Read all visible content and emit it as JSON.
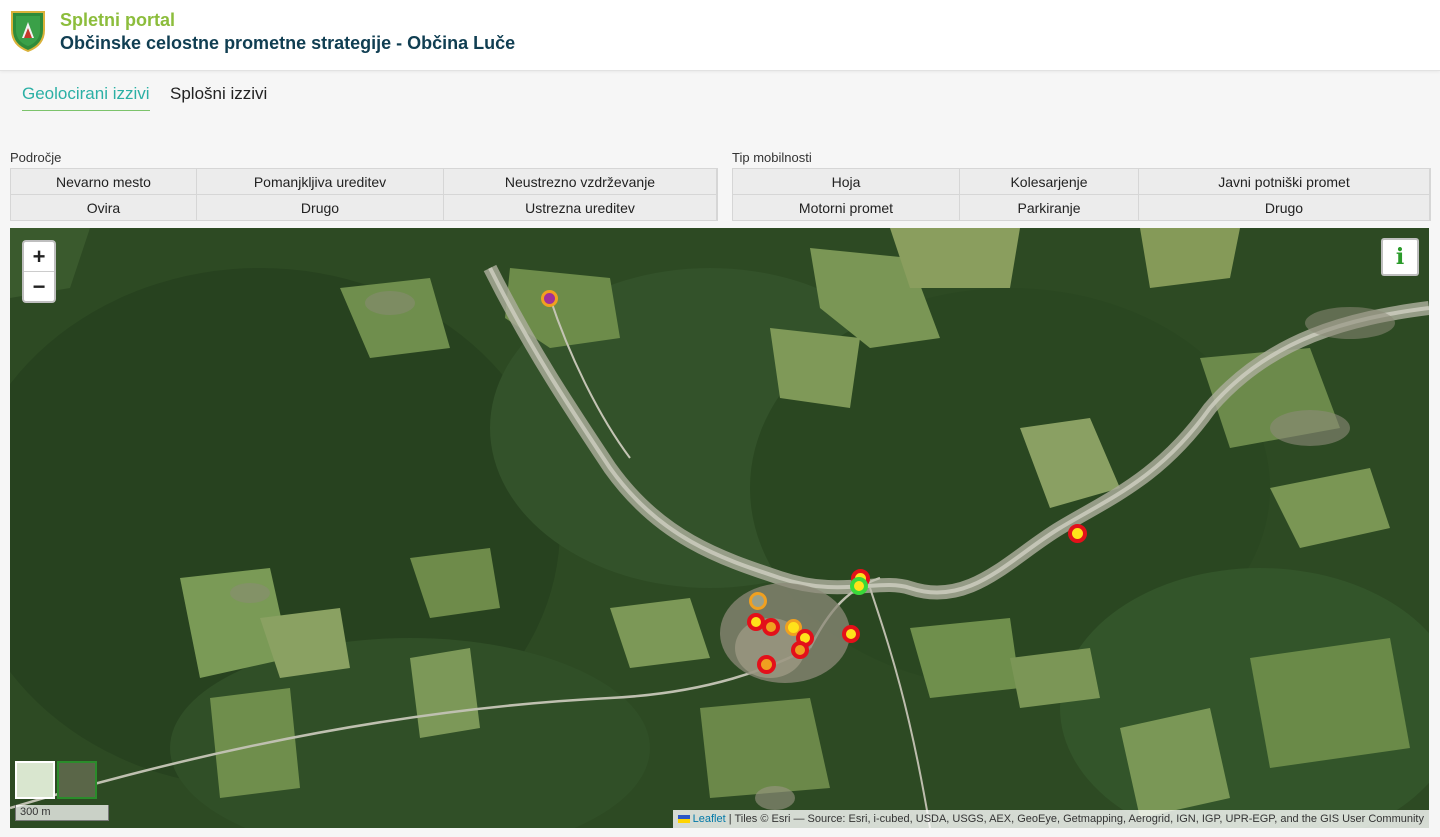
{
  "header": {
    "title": "Spletni portal",
    "subtitle": "Občinske celostne prometne strategije - Občina Luče",
    "logo_icon": "coat-of-arms-icon"
  },
  "tabs": [
    {
      "label": "Geolocirani izzivi",
      "active": true
    },
    {
      "label": "Splošni izzivi",
      "active": false
    }
  ],
  "filters": {
    "area": {
      "label": "Področje",
      "buttons": [
        "Nevarno mesto",
        "Pomanjkljiva ureditev",
        "Neustrezno vzdrževanje",
        "Ovira",
        "Drugo",
        "Ustrezna ureditev"
      ]
    },
    "mobility": {
      "label": "Tip mobilnosti",
      "buttons": [
        "Hoja",
        "Kolesarjenje",
        "Javni potniški promet",
        "Motorni promet",
        "Parkiranje",
        "Drugo"
      ]
    }
  },
  "map": {
    "zoom_in": "+",
    "zoom_out": "−",
    "info_icon": "info-icon",
    "info_glyph": "i",
    "scale": "300 m",
    "attribution_link": "Leaflet",
    "attribution_text": " | Tiles © Esri — Source: Esri, i-cubed, USDA, USGS, AEX, GeoEye, Getmapping, Aerogrid, IGN, IGP, UPR-EGP, and the GIS User Community",
    "colors": {
      "red": "#e3101a",
      "yellow": "#ffe21a",
      "orange": "#f0a020",
      "green": "#3ad83a",
      "purple": "#a0309a",
      "gray": "#9aa08a"
    }
  }
}
